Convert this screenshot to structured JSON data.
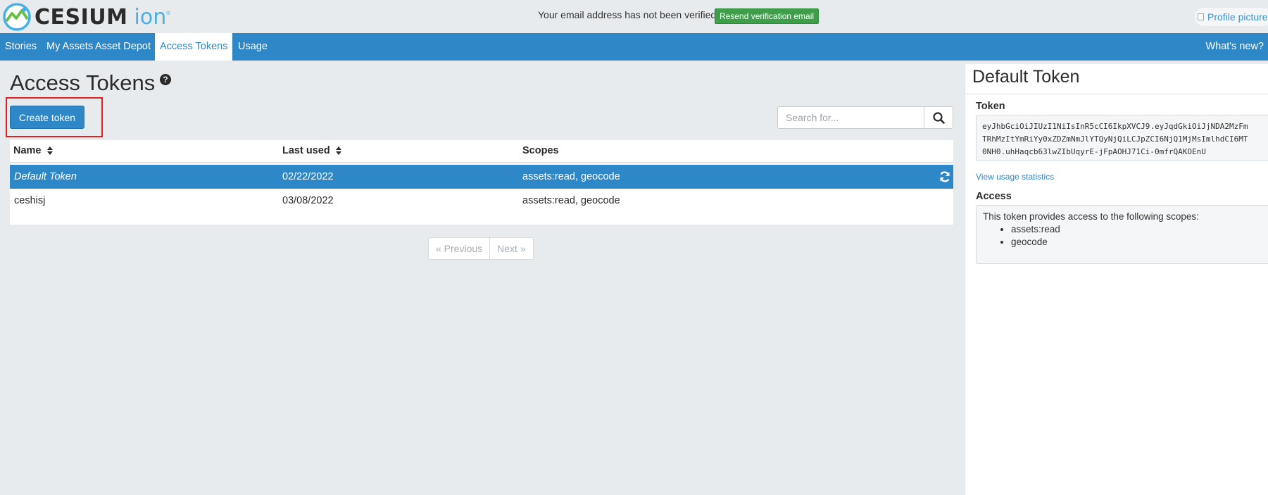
{
  "logo": {
    "brand": "CESIUM",
    "product": "ion",
    "tm": "®"
  },
  "banner": {
    "message": "Your email address has not been verified.",
    "resend_label": "Resend verification email"
  },
  "profile": {
    "alt_text": "Profile picture"
  },
  "nav": {
    "items": [
      {
        "label": "Stories",
        "active": false
      },
      {
        "label": "My Assets",
        "active": false
      },
      {
        "label": "Asset Depot",
        "active": false
      },
      {
        "label": "Access Tokens",
        "active": true
      },
      {
        "label": "Usage",
        "active": false
      }
    ],
    "whats_new": "What's new?"
  },
  "page": {
    "title": "Access Tokens",
    "help_icon": "question-circle-icon",
    "create_label": "Create token",
    "search_placeholder": "Search for..."
  },
  "table": {
    "columns": [
      "Name",
      "Last used",
      "Scopes"
    ],
    "rows": [
      {
        "name": "Default Token",
        "last_used": "02/22/2022",
        "scopes": "assets:read, geocode",
        "selected": true
      },
      {
        "name": "ceshisj",
        "last_used": "03/08/2022",
        "scopes": "assets:read, geocode",
        "selected": false
      }
    ]
  },
  "pagination": {
    "previous": "« Previous",
    "next": "Next »"
  },
  "details": {
    "title": "Default Token",
    "token_label": "Token",
    "token_lines": [
      "eyJhbGciOiJIUzI1NiIsInR5cCI6IkpXVCJ9.eyJqdGkiOiJjNDA2MzFm",
      "TRhMzItYmRiYy0xZDZmNmJlYTQyNjQiLCJpZCI6NjQ1MjMsImlhdCI6MT",
      "0NH0.uhHaqcb63lwZIbUqyrE-jFpAOHJ71Ci-0mfrQAKOEnU"
    ],
    "usage_link": "View usage statistics",
    "access_label": "Access",
    "access_text": "This token provides access to the following scopes:",
    "scopes": [
      "assets:read",
      "geocode"
    ]
  },
  "colors": {
    "primary": "#2e88c7",
    "success": "#3e9e49",
    "highlight": "#e02020",
    "page_bg": "#e8ebee"
  }
}
